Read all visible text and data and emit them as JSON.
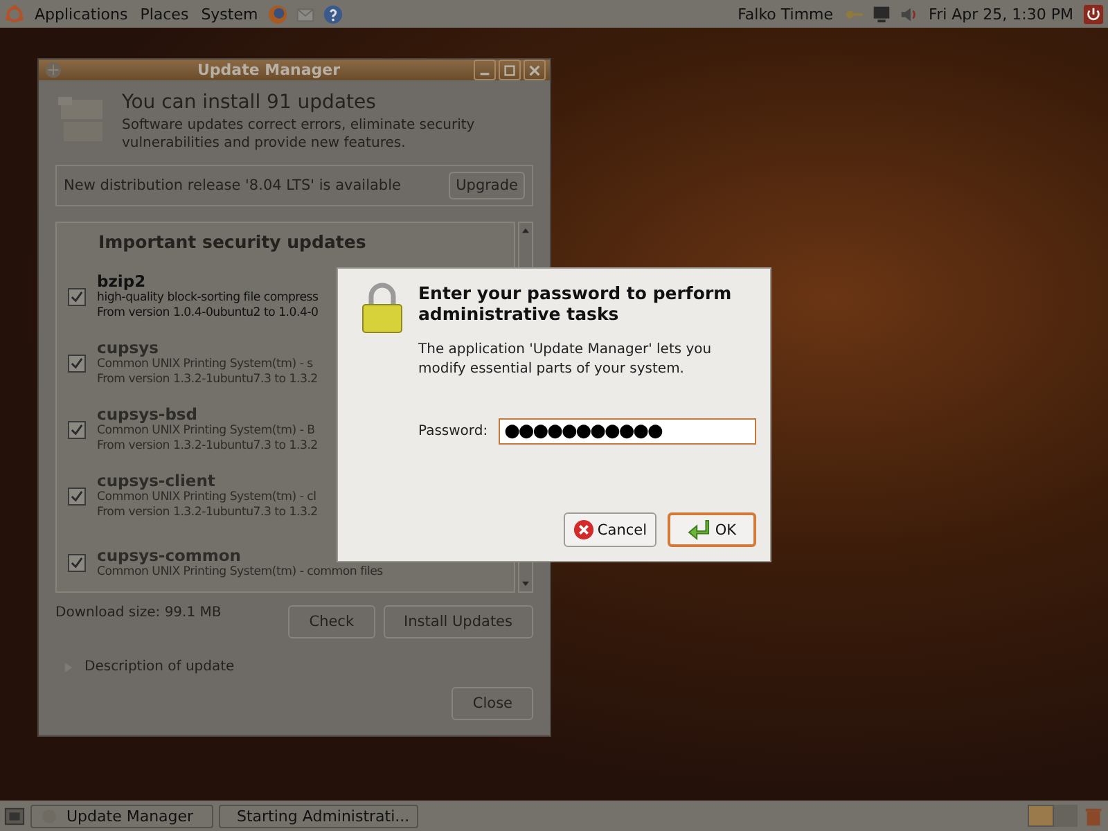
{
  "top_panel": {
    "menus": [
      "Applications",
      "Places",
      "System"
    ],
    "user": "Falko Timme",
    "clock": "Fri Apr 25,  1:30 PM"
  },
  "update_window": {
    "title": "Update Manager",
    "heading": "You can install 91 updates",
    "subtitle": "Software updates correct errors, eliminate security vulnerabilities and provide new features.",
    "release_notice": "New distribution release '8.04 LTS' is available",
    "upgrade_button": "Upgrade",
    "list_heading": "Important security updates",
    "packages": [
      {
        "name": "bzip2",
        "description": "high-quality block-sorting file compress",
        "version": "From version 1.0.4-0ubuntu2 to 1.0.4-0",
        "checked": true,
        "selected": true
      },
      {
        "name": "cupsys",
        "description": "Common UNIX Printing System(tm) - s",
        "version": "From version 1.3.2-1ubuntu7.3 to 1.3.2",
        "checked": true,
        "selected": false
      },
      {
        "name": "cupsys-bsd",
        "description": "Common UNIX Printing System(tm) - B",
        "version": "From version 1.3.2-1ubuntu7.3 to 1.3.2",
        "checked": true,
        "selected": false
      },
      {
        "name": "cupsys-client",
        "description": "Common UNIX Printing System(tm) - cl",
        "version": "From version 1.3.2-1ubuntu7.3 to 1.3.2",
        "checked": true,
        "selected": false
      },
      {
        "name": "cupsys-common",
        "description": "Common UNIX Printing System(tm) - common files",
        "checked": true,
        "selected": false
      }
    ],
    "download_size": "Download size: 99.1 MB",
    "check_button": "Check",
    "install_button": "Install Updates",
    "expander": {
      "label": "Description of update",
      "expanded": false
    },
    "close_button": "Close"
  },
  "auth_dialog": {
    "title": "Enter your password to perform administrative tasks",
    "message": "The application 'Update Manager' lets you modify essential parts of your system.",
    "password_label": "Password:",
    "password_value": "●●●●●●●●●●●",
    "cancel_button": "Cancel",
    "ok_button": "OK"
  },
  "taskbar": {
    "items": [
      {
        "label": "Update Manager",
        "selected": false
      },
      {
        "label": "Starting Administrati...",
        "selected": false
      }
    ]
  }
}
